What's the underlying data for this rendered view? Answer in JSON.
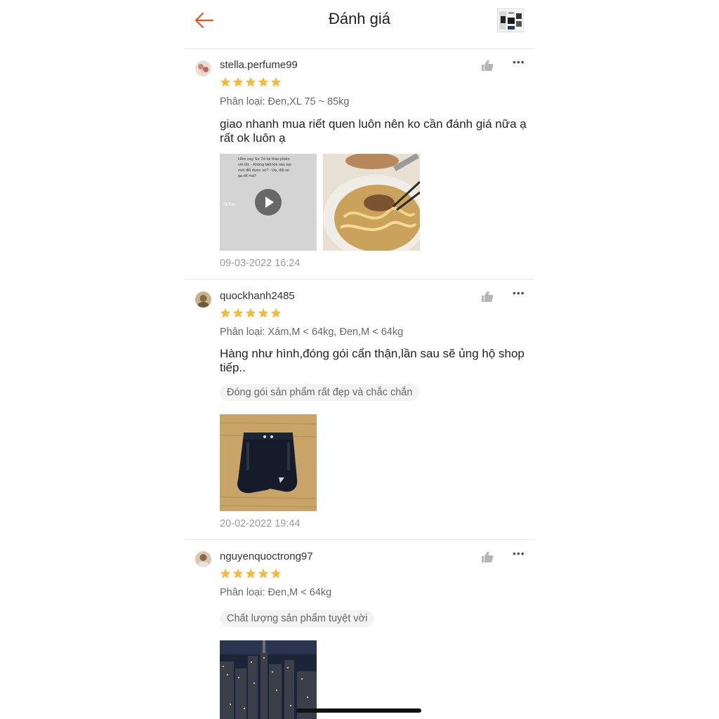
{
  "header": {
    "title": "Đánh giá",
    "back_icon": "back-arrow-icon",
    "accent": "#e1552b"
  },
  "reviews": [
    {
      "username": "stella.perfume99",
      "rating": 5,
      "variant": "Phân loại: Đen,XL 75 ~ 85kg",
      "comment": "giao nhanh mua riết quen luôn nên ko cần đánh giá nữa ạ rất ok luôn ạ",
      "video_text": "Hôm nay Sư Tử lại than phiền với tôi: - Không biết khi nào tao mới đổi được xe? - Ủa, đổi xe ga để mà?",
      "video_brand": "TikTok",
      "date": "09-03-2022 16:24"
    },
    {
      "username": "quockhanh2485",
      "rating": 5,
      "variant": "Phân loại: Xám,M < 64kg, Đen,M < 64kg",
      "comment": "Hàng như hình,đóng gói cẩn thận,lần sau sẽ ủng hộ shop tiếp..",
      "tag": "Đóng gói sản phẩm rất đẹp và chắc chắn",
      "date": "20-02-2022 19:44"
    },
    {
      "username": "nguyenquoctrong97",
      "rating": 5,
      "variant": "Phân loại: Đen,M < 64kg",
      "tag": "Chất lượng sản phẩm tuyệt vời"
    }
  ],
  "colors": {
    "star": "#f6b93b",
    "muted": "#9a9a9a",
    "divider": "#e8e8e8"
  }
}
